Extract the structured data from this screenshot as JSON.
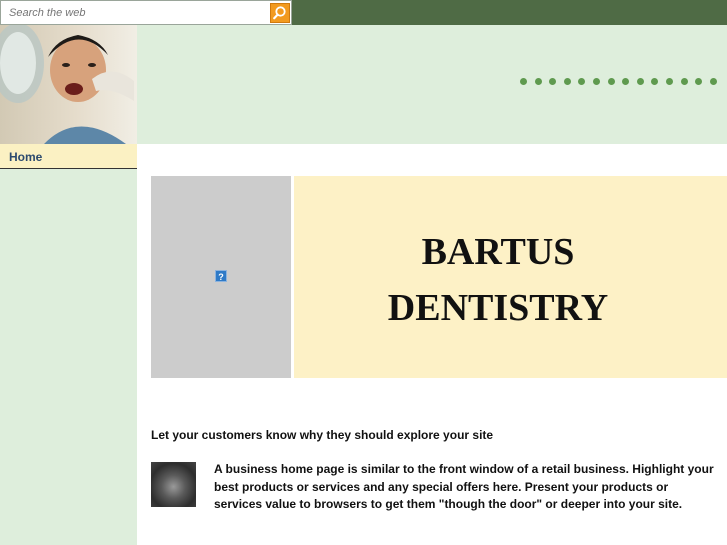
{
  "search": {
    "placeholder": "Search the web"
  },
  "sidebar": {
    "items": [
      {
        "label": "Home"
      }
    ]
  },
  "hero": {
    "title_line1": "BARTUS",
    "title_line2": "DENTISTRY",
    "broken_image_glyph": "?"
  },
  "content": {
    "tagline": "Let your customers know why they should explore your site",
    "body": "A business home page is similar to the front window of a retail business. Highlight your best products or services and any special offers here. Present your products or services value to browsers to get them \"though the door\" or deeper into your site."
  },
  "icons": {
    "search_button": "magnifier-icon",
    "hero_placeholder": "broken-image-icon"
  },
  "colors": {
    "topbar": "#4f6b45",
    "header_bg": "#deeedc",
    "accent_dots": "#5f9a4f",
    "hero_panel": "#fdf1c6",
    "nav_active": "#fbf1c3",
    "search_button": "#f29a1f"
  }
}
